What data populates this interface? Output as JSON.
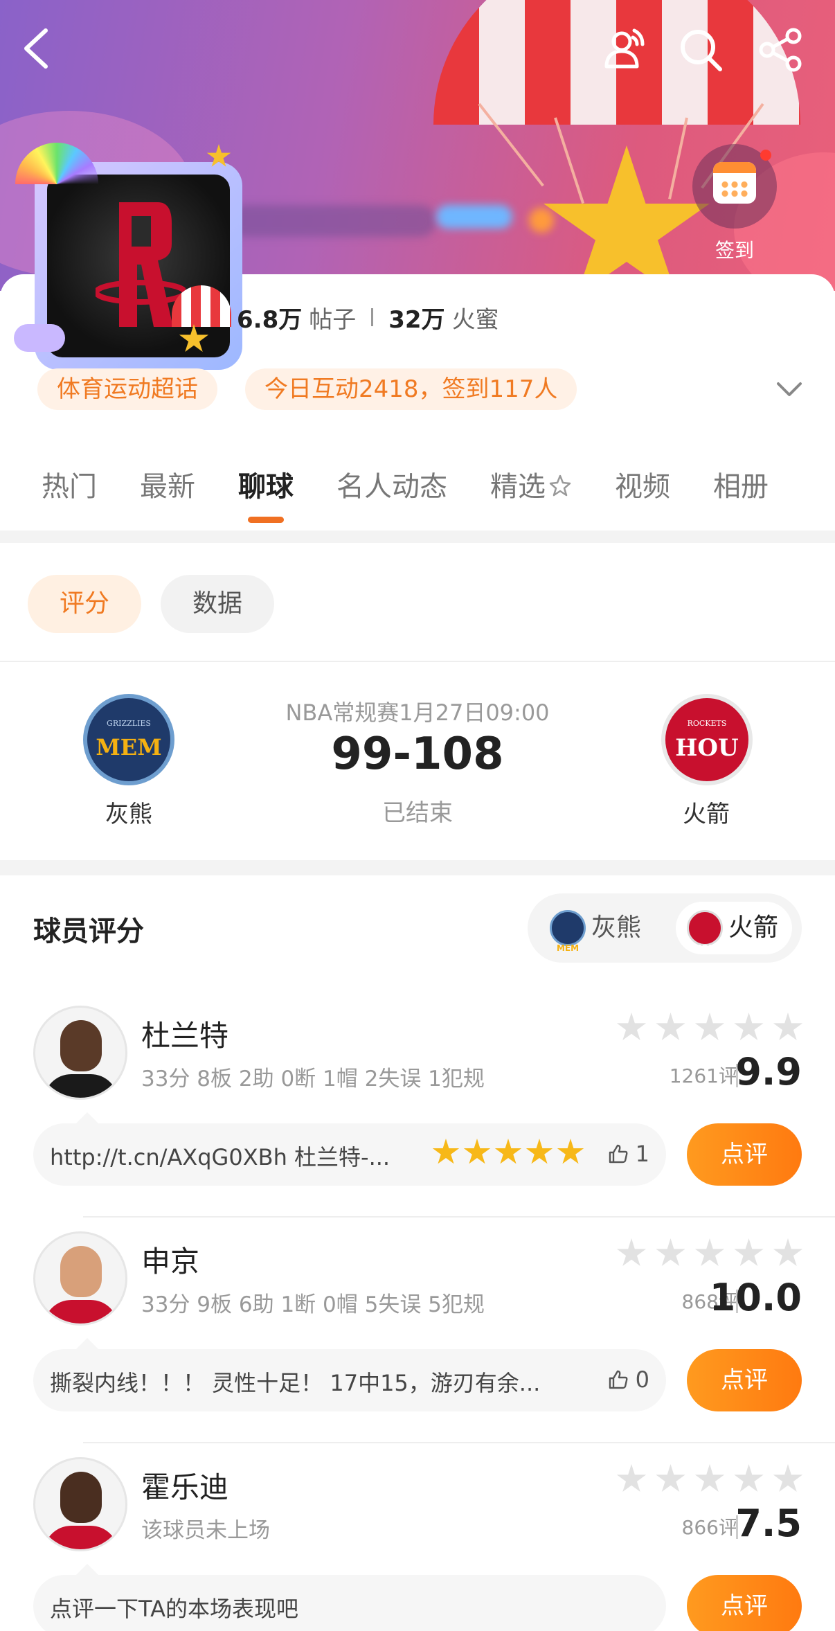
{
  "header": {
    "signin_label": "签到",
    "posts_count": "6.8万",
    "posts_label": "帖子",
    "fans_count": "32万",
    "fans_label": "火蜜",
    "tags": [
      "体育运动超话",
      "今日互动2418，签到117人"
    ]
  },
  "tabs": [
    {
      "label": "热门",
      "active": false
    },
    {
      "label": "最新",
      "active": false
    },
    {
      "label": "聊球",
      "active": true
    },
    {
      "label": "名人动态",
      "active": false
    },
    {
      "label": "精选",
      "active": false
    },
    {
      "label": "视频",
      "active": false
    },
    {
      "label": "相册",
      "active": false
    }
  ],
  "sub_tabs": {
    "rating": "评分",
    "data": "数据"
  },
  "match": {
    "info": "NBA常规赛1月27日09:00",
    "score": "99-108",
    "status": "已结束",
    "home": {
      "name": "灰熊",
      "abbr": "MEM",
      "logo_small": "GRIZZLIES",
      "color": "#1f3a6a"
    },
    "away": {
      "name": "火箭",
      "abbr": "HOU",
      "logo_small": "ROCKETS",
      "color": "#c8102e"
    }
  },
  "ratings": {
    "title": "球员评分",
    "team_switch": [
      {
        "label": "灰熊",
        "active": false
      },
      {
        "label": "火箭",
        "active": true
      }
    ],
    "review_button": "点评",
    "players": [
      {
        "name": "杜兰特",
        "stats": "33分 8板 2助 0断 1帽 2失误 1犯规",
        "review_count": "1261评",
        "score": "9.9",
        "comment": "http://t.cn/AXqG0XBh 杜兰特-...",
        "comment_stars": 5,
        "likes": "1"
      },
      {
        "name": "申京",
        "stats": "33分 9板 6助 1断 0帽 5失误 5犯规",
        "review_count": "868评",
        "score": "10.0",
        "comment": "撕裂内线！！！ 灵性十足！ 17中15，游刃有余...",
        "likes": "0"
      },
      {
        "name": "霍乐迪",
        "stats": "该球员未上场",
        "review_count": "866评",
        "score": "7.5",
        "comment": "点评一下TA的本场表现吧"
      }
    ]
  },
  "colors": {
    "accent": "#f07022",
    "review_button": "#ff8a16"
  }
}
